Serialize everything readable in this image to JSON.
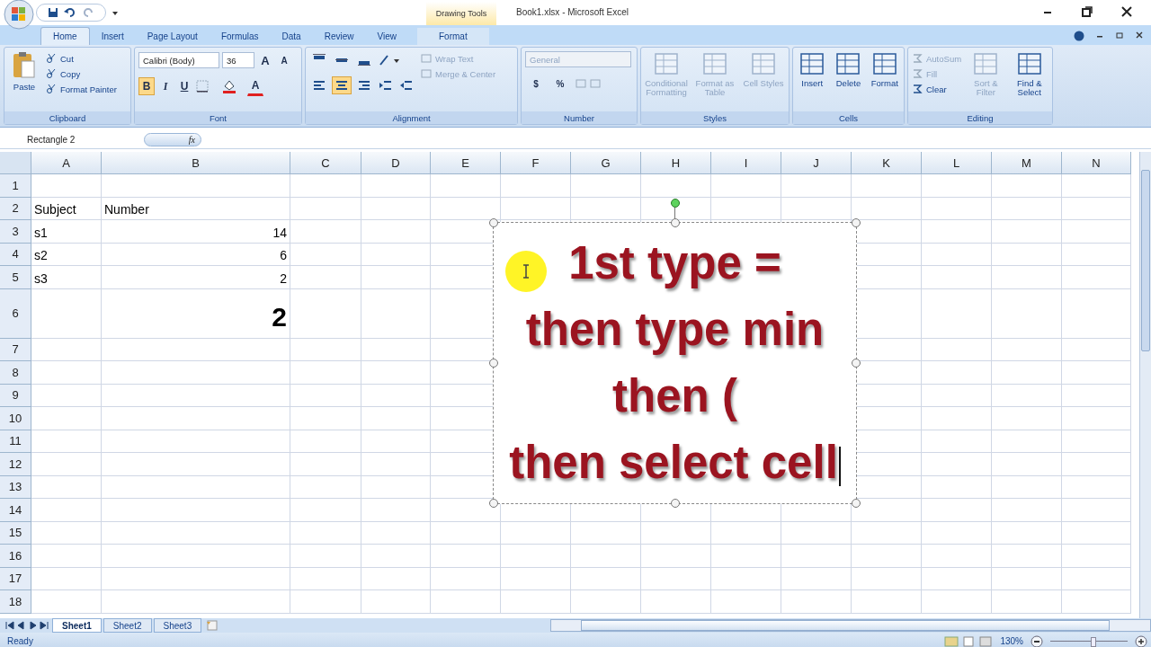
{
  "title_bar": {
    "context_label": "Drawing Tools",
    "title": "Book1.xlsx - Microsoft Excel"
  },
  "ribbon_tabs": [
    {
      "label": "Home",
      "selected": true,
      "kind": "normal"
    },
    {
      "label": "Insert",
      "selected": false,
      "kind": "normal"
    },
    {
      "label": "Page Layout",
      "selected": false,
      "kind": "normal"
    },
    {
      "label": "Formulas",
      "selected": false,
      "kind": "normal"
    },
    {
      "label": "Data",
      "selected": false,
      "kind": "normal"
    },
    {
      "label": "Review",
      "selected": false,
      "kind": "normal"
    },
    {
      "label": "View",
      "selected": false,
      "kind": "normal"
    },
    {
      "label": "Format",
      "selected": false,
      "kind": "contextual"
    }
  ],
  "ribbon_groups": [
    {
      "kind": "clipboard",
      "title": "Clipboard",
      "large": [
        {
          "label": "Paste",
          "disabled": false
        }
      ],
      "small": [
        {
          "label": "Cut",
          "disabled": false
        },
        {
          "label": "Copy",
          "disabled": false
        },
        {
          "label": "Format Painter",
          "disabled": false
        }
      ]
    },
    {
      "kind": "font",
      "title": "Font",
      "font_name": "Calibri (Body)",
      "font_size": "36",
      "size_buttons": [
        "A",
        "A"
      ],
      "style_buttons": [
        {
          "label": "B",
          "selected": true
        },
        {
          "label": "I",
          "selected": false
        },
        {
          "label": "U",
          "selected": false
        }
      ],
      "font_color_label": "A"
    },
    {
      "kind": "alignment",
      "title": "Alignment",
      "top_buttons": [
        {
          "selected": false
        },
        {
          "selected": false
        },
        {
          "selected": false
        }
      ],
      "bottom_buttons": [
        {
          "selected": false
        },
        {
          "selected": true
        },
        {
          "selected": false
        }
      ],
      "commands": [
        {
          "label": "Wrap Text",
          "disabled": true
        },
        {
          "label": "Merge & Center",
          "disabled": true
        }
      ]
    },
    {
      "kind": "number",
      "title": "Number",
      "format": {
        "value": "General",
        "disabled": true
      },
      "symbols": [
        "$",
        "%"
      ]
    },
    {
      "kind": "large",
      "title": "Styles",
      "large": [
        {
          "label": "Conditional Formatting",
          "disabled": true
        },
        {
          "label": "Format as Table",
          "disabled": true
        },
        {
          "label": "Cell Styles",
          "disabled": true
        }
      ]
    },
    {
      "kind": "large",
      "title": "Cells",
      "large": [
        {
          "label": "Insert",
          "disabled": false
        },
        {
          "label": "Delete",
          "disabled": false
        },
        {
          "label": "Format",
          "disabled": false
        }
      ]
    },
    {
      "kind": "editing",
      "title": "Editing",
      "small": [
        {
          "label": "AutoSum",
          "disabled": true
        },
        {
          "label": "Fill",
          "disabled": true
        },
        {
          "label": "Clear",
          "disabled": false
        }
      ],
      "large": [
        {
          "label": "Sort & Filter",
          "disabled": true
        },
        {
          "label": "Find & Select",
          "disabled": false
        }
      ]
    }
  ],
  "formula_bar": {
    "name_box": "Rectangle 2",
    "function_label": "fx"
  },
  "columns": [
    "A",
    "B",
    "C",
    "D",
    "E",
    "F",
    "G",
    "H",
    "I",
    "J",
    "K",
    "L",
    "M",
    "N"
  ],
  "rows": [
    {
      "label": "1",
      "cells": {}
    },
    {
      "label": "2",
      "cells": {
        "A": {
          "text": "Subject",
          "kind": "text"
        },
        "B": {
          "text": "Number",
          "kind": "text"
        }
      }
    },
    {
      "label": "3",
      "cells": {
        "A": {
          "text": "s1",
          "kind": "text"
        },
        "B": {
          "text": "14",
          "kind": "number"
        }
      }
    },
    {
      "label": "4",
      "cells": {
        "A": {
          "text": "s2",
          "kind": "text"
        },
        "B": {
          "text": "6",
          "kind": "number"
        }
      }
    },
    {
      "label": "5",
      "cells": {
        "A": {
          "text": "s3",
          "kind": "text"
        },
        "B": {
          "text": "2",
          "kind": "number"
        }
      }
    },
    {
      "label": "6",
      "cells": {
        "B": {
          "text": "2",
          "kind": "large"
        }
      }
    },
    {
      "label": "7",
      "cells": {}
    },
    {
      "label": "8",
      "cells": {}
    },
    {
      "label": "9",
      "cells": {}
    },
    {
      "label": "10",
      "cells": {}
    },
    {
      "label": "11",
      "cells": {}
    },
    {
      "label": "12",
      "cells": {}
    },
    {
      "label": "13",
      "cells": {}
    },
    {
      "label": "14",
      "cells": {}
    },
    {
      "label": "15",
      "cells": {}
    },
    {
      "label": "16",
      "cells": {}
    },
    {
      "label": "17",
      "cells": {}
    },
    {
      "label": "18",
      "cells": {}
    }
  ],
  "textbox": {
    "selected": true,
    "caret": true,
    "lines": [
      "1st type =",
      "then type min",
      "then (",
      "then select cell"
    ]
  },
  "sheet_tabs": [
    {
      "label": "Sheet1",
      "selected": true
    },
    {
      "label": "Sheet2",
      "selected": false
    },
    {
      "label": "Sheet3",
      "selected": false
    }
  ],
  "status_bar": {
    "status": "Ready",
    "zoom": "130%",
    "zoom_slider": {
      "level": 0.55
    }
  }
}
